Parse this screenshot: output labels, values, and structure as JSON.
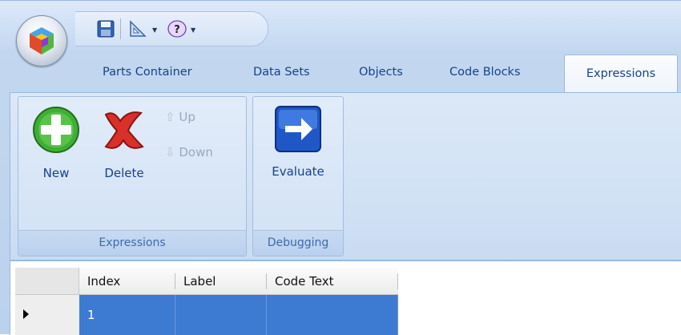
{
  "qat": {
    "save_icon": "save-icon",
    "design_icon": "triangle-ruler-icon",
    "help_icon": "help-icon"
  },
  "tabs": [
    {
      "label": "Parts Container"
    },
    {
      "label": "Data Sets"
    },
    {
      "label": "Objects"
    },
    {
      "label": "Code Blocks"
    },
    {
      "label": "Expressions"
    }
  ],
  "active_tab": "Expressions",
  "ribbon": {
    "groups": [
      {
        "caption": "Expressions",
        "buttons": {
          "new": "New",
          "delete": "Delete",
          "up": "Up",
          "down": "Down"
        }
      },
      {
        "caption": "Debugging",
        "buttons": {
          "evaluate": "Evaluate"
        }
      }
    ]
  },
  "grid": {
    "columns": [
      "Index",
      "Label",
      "Code Text"
    ],
    "rows": [
      {
        "index": "1",
        "label": "",
        "code_text": ""
      }
    ]
  },
  "colors": {
    "accent": "#15428b",
    "selection": "#3d7ad1",
    "ribbon_bg": "#d2e2f5"
  }
}
